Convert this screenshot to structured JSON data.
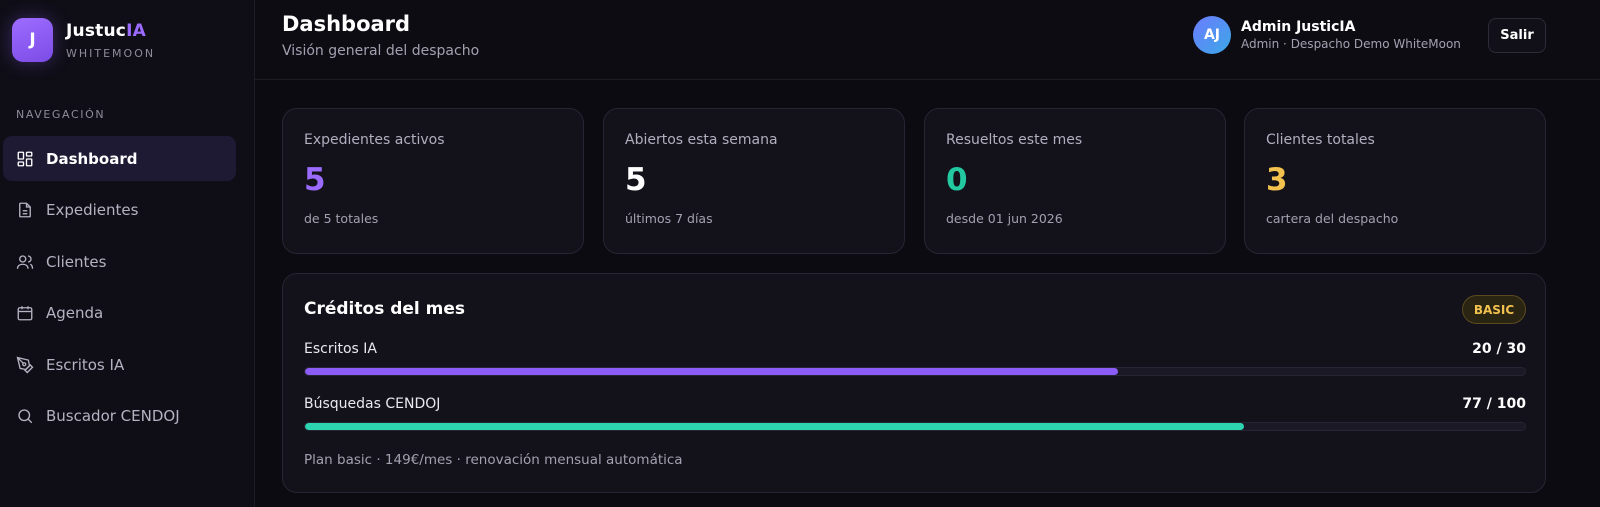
{
  "brand": {
    "logo_letter": "J",
    "name_main": "Justuc",
    "name_accent": "IA",
    "subtitle": "WHITEMOON",
    "accent_color": "#9b6bff"
  },
  "sidebar": {
    "section_title": "NAVEGACIÓN",
    "items": [
      {
        "label": "Dashboard",
        "icon": "dashboard-icon",
        "active": true
      },
      {
        "label": "Expedientes",
        "icon": "file-icon",
        "active": false
      },
      {
        "label": "Clientes",
        "icon": "users-icon",
        "active": false
      },
      {
        "label": "Agenda",
        "icon": "calendar-icon",
        "active": false
      },
      {
        "label": "Escritos IA",
        "icon": "pen-icon",
        "active": false
      },
      {
        "label": "Buscador CENDOJ",
        "icon": "search-icon",
        "active": false
      }
    ]
  },
  "header": {
    "title": "Dashboard",
    "subtitle": "Visión general del despacho",
    "user": {
      "initials": "AJ",
      "name": "Admin JusticIA",
      "role": "Admin · Despacho Demo WhiteMoon"
    },
    "logout_label": "Salir"
  },
  "stats": [
    {
      "label": "Expedientes activos",
      "value": "5",
      "note": "de 5 totales",
      "color": "#9b6bff"
    },
    {
      "label": "Abiertos esta semana",
      "value": "5",
      "note": "últimos 7 días",
      "color": "#ffffff"
    },
    {
      "label": "Resueltos este mes",
      "value": "0",
      "note": "desde 01 jun 2026",
      "color": "#22c9a0"
    },
    {
      "label": "Clientes totales",
      "value": "3",
      "note": "cartera del despacho",
      "color": "#f2c14e"
    }
  ],
  "credits": {
    "title": "Créditos del mes",
    "badge": "BASIC",
    "meters": [
      {
        "label": "Escritos IA",
        "count": "20 / 30",
        "used": 20,
        "total": 30,
        "color": "#8b5cf6"
      },
      {
        "label": "Búsquedas CENDOJ",
        "count": "77 / 100",
        "used": 77,
        "total": 100,
        "color": "#2dd4b0"
      }
    ],
    "plan_text": "Plan basic · 149€/mes · renovación mensual automática"
  }
}
